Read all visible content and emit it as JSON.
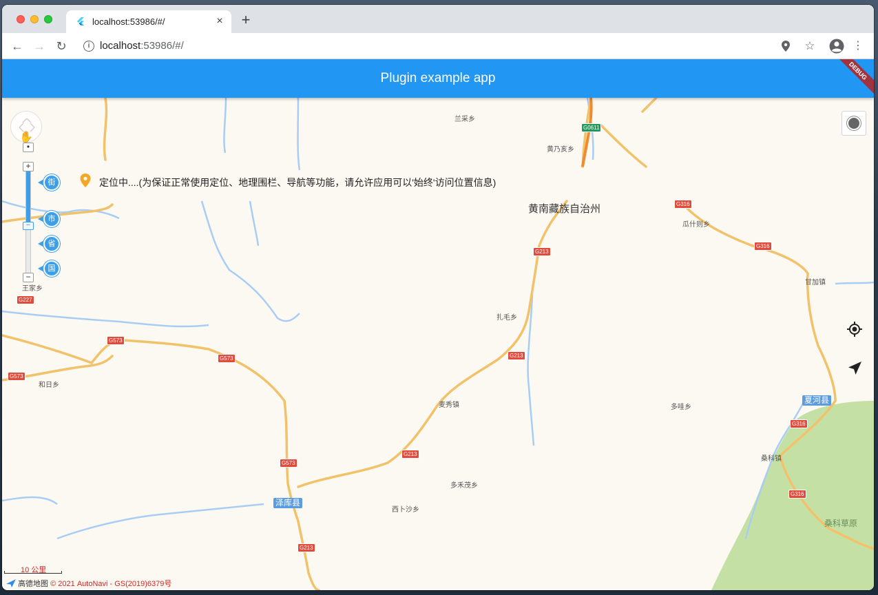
{
  "browser": {
    "tab_title": "localhost:53986/#/",
    "tab_close": "×",
    "new_tab": "+",
    "url_host": "localhost",
    "url_rest": ":53986/#/"
  },
  "app": {
    "title": "Plugin example app",
    "debug_label": "DEBUG"
  },
  "map": {
    "location_status": "定位中....(为保证正常使用定位、地理围栏、导航等功能，请允许应用可以'始终'访问位置信息)",
    "zoom_levels": [
      "街",
      "市",
      "省",
      "国"
    ],
    "places": {
      "lancai": "兰采乡",
      "huangnaihai": "黄乃亥乡",
      "huangnan": "黄南藏族自治州",
      "guashize": "瓜什则乡",
      "wangjia": "王家乡",
      "ganjia": "甘加镇",
      "zhamao": "扎毛乡",
      "heri": "和日乡",
      "maixiu": "麦秀镇",
      "duowa": "多哇乡",
      "xiahe": "夏河县",
      "sangke": "桑科镇",
      "duohemao": "多禾茂乡",
      "zeku": "泽库县",
      "xibusha": "西卜沙乡",
      "sangke_grassland": "桑科草原"
    },
    "roads": {
      "g0611": "G0611",
      "g316": "G316",
      "g213": "G213",
      "g227": "G227",
      "g573": "G573"
    },
    "scale_label": "10 公里",
    "attribution_logo": "高德地图",
    "attribution_copy": "© 2021 AutoNavi - GS(2019)6379号",
    "colors": {
      "appbar": "#2196f3",
      "river": "#a8cdf5",
      "road": "#f2c26b",
      "grassland": "#c5e0a5"
    }
  }
}
